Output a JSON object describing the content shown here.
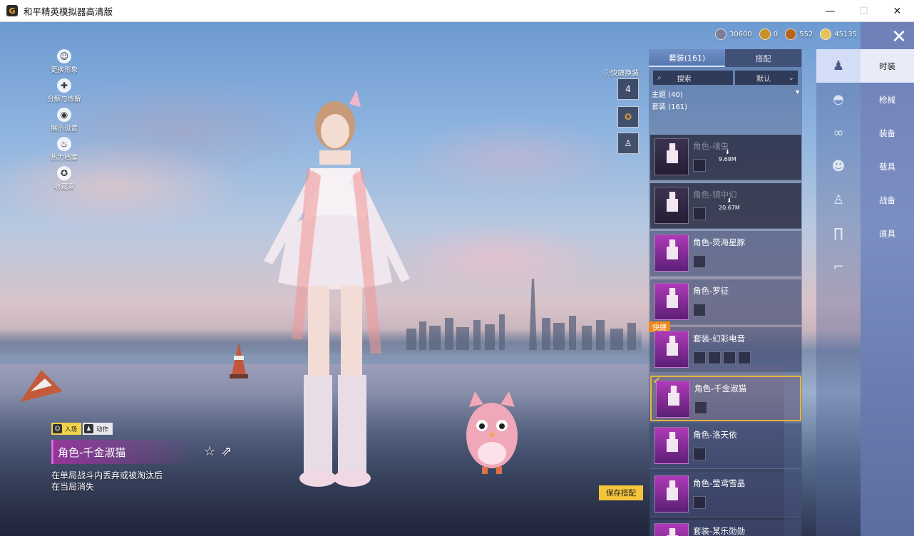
{
  "window": {
    "title": "和平精英模拟器高清版",
    "app_icon": "G",
    "controls": {
      "minimize": "—",
      "maximize": "☐",
      "close": "✕"
    }
  },
  "currency": [
    {
      "icon": "coin-icon",
      "value": "30600"
    },
    {
      "icon": "token-icon",
      "value": "0"
    },
    {
      "icon": "badge-icon",
      "value": "552"
    },
    {
      "icon": "gold-icon",
      "value": "45135"
    }
  ],
  "left_menu": [
    {
      "label": "更换形象",
      "icon": "person-icon",
      "glyph": "☺"
    },
    {
      "label": "分解与炼解",
      "icon": "puzzle-icon",
      "glyph": "✚"
    },
    {
      "label": "展示设置",
      "icon": "eye-icon",
      "glyph": "◉"
    },
    {
      "label": "热力档案",
      "icon": "fire-icon",
      "glyph": "♨"
    },
    {
      "label": "收藏家",
      "icon": "collector-icon",
      "glyph": "✪"
    }
  ],
  "skin_info": {
    "tag_enter": "入场",
    "tag_action": "动作",
    "name": "角色-千金淑猫",
    "description": "在单局战斗内丢弃或被淘汰后在当局消失",
    "favorite_glyph": "☆",
    "share_glyph": "⇗"
  },
  "quick_change": {
    "label": "快捷换装",
    "slot_number": "4"
  },
  "save_button": "保存搭配",
  "panel": {
    "tabs": [
      "套装(161)",
      "搭配"
    ],
    "search_label": "搜索",
    "sort_label": "默认",
    "theme_label": "主题 (40)",
    "set_count_label": "套装 (161)",
    "quick_badge": "快捷",
    "items": [
      {
        "name": "角色-魂虫",
        "download": "9.68M",
        "dim": true,
        "mini_count": 1
      },
      {
        "name": "角色-镜中幻",
        "download": "20.67M",
        "dim": true,
        "mini_count": 1
      },
      {
        "name": "角色-荧海星豚",
        "download": "",
        "dim": false,
        "mini_count": 1
      },
      {
        "name": "角色-罗征",
        "download": "",
        "dim": false,
        "mini_count": 1
      },
      {
        "name": "套装-幻彩电音",
        "download": "",
        "dim": false,
        "mini_count": 4,
        "quick": true
      },
      {
        "name": "角色-千金淑猫",
        "download": "",
        "dim": false,
        "mini_count": 1,
        "selected": true
      },
      {
        "name": "角色-洛天依",
        "download": "",
        "dim": false,
        "mini_count": 1
      },
      {
        "name": "角色-莹鸢雪晶",
        "download": "",
        "dim": false,
        "mini_count": 1
      },
      {
        "name": "套装-某乐勋勋",
        "download": "",
        "dim": false,
        "mini_count": 1
      }
    ]
  },
  "category_icons": [
    {
      "icon": "character-icon",
      "glyph": "♟",
      "active": true
    },
    {
      "icon": "cap-icon",
      "glyph": "◓"
    },
    {
      "icon": "glasses-icon",
      "glyph": "∞"
    },
    {
      "icon": "mask-icon",
      "glyph": "☻"
    },
    {
      "icon": "outfit-icon",
      "glyph": "♙"
    },
    {
      "icon": "pants-icon",
      "glyph": "∏"
    },
    {
      "icon": "shoes-icon",
      "glyph": "⌐"
    }
  ],
  "categories": [
    "时装",
    "枪械",
    "装备",
    "载具",
    "战备",
    "道具"
  ],
  "close_glyph": "✕"
}
